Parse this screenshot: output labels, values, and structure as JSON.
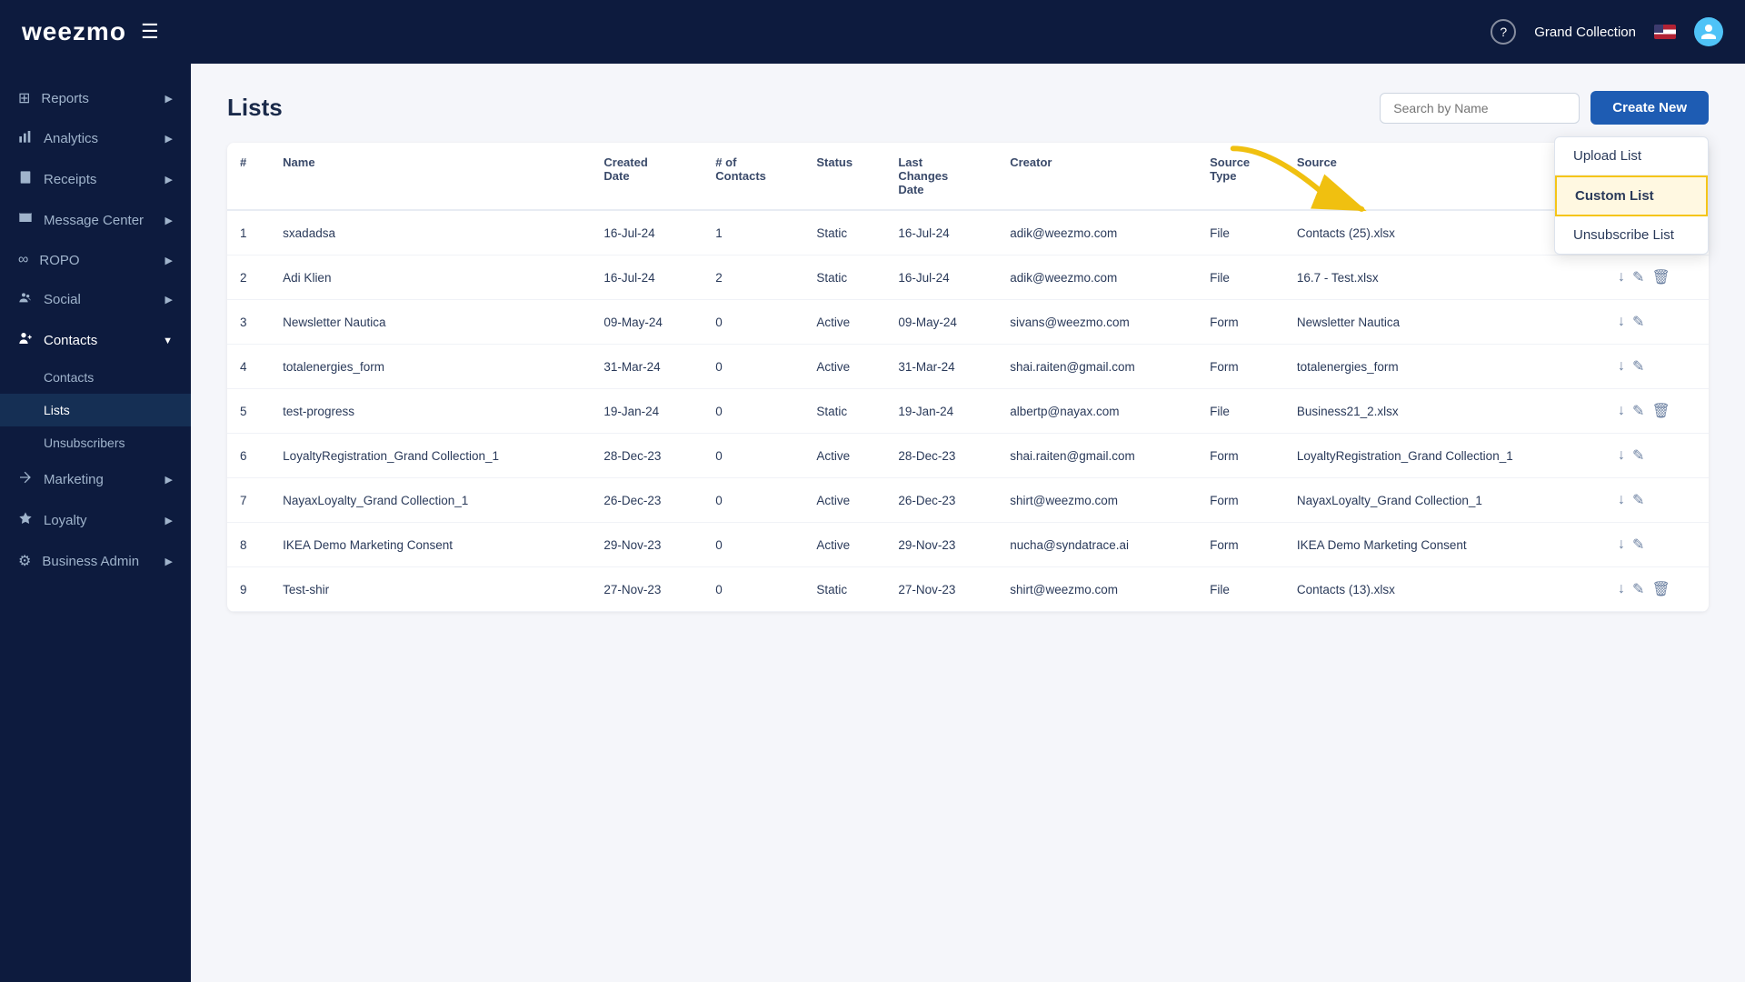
{
  "navbar": {
    "logo": "weezmo",
    "org_name": "Grand Collection",
    "help_label": "?",
    "user_icon": "person"
  },
  "sidebar": {
    "items": [
      {
        "id": "reports",
        "label": "Reports",
        "icon": "⊞",
        "arrow": "▶"
      },
      {
        "id": "analytics",
        "label": "Analytics",
        "icon": "📊",
        "arrow": "▶"
      },
      {
        "id": "receipts",
        "label": "Receipts",
        "icon": "🧾",
        "arrow": "▶"
      },
      {
        "id": "message-center",
        "label": "Message Center",
        "icon": "💬",
        "arrow": "▶"
      },
      {
        "id": "ropo",
        "label": "ROPO",
        "icon": "∞",
        "arrow": "▶"
      },
      {
        "id": "social",
        "label": "Social",
        "icon": "👥",
        "arrow": "▶"
      },
      {
        "id": "contacts",
        "label": "Contacts",
        "icon": "👤",
        "arrow": "▼"
      }
    ],
    "contacts_sub": [
      {
        "id": "contacts-sub",
        "label": "Contacts"
      },
      {
        "id": "lists",
        "label": "Lists"
      },
      {
        "id": "unsubscribers",
        "label": "Unsubscribers"
      }
    ],
    "bottom_items": [
      {
        "id": "marketing",
        "label": "Marketing",
        "icon": "📢",
        "arrow": "▶"
      },
      {
        "id": "loyalty",
        "label": "Loyalty",
        "icon": "🏷️",
        "arrow": "▶"
      },
      {
        "id": "business-admin",
        "label": "Business Admin",
        "icon": "⚙️",
        "arrow": "▶"
      }
    ]
  },
  "page": {
    "title": "Lists",
    "search_placeholder": "Search by Name",
    "create_btn": "Create New"
  },
  "dropdown": {
    "items": [
      {
        "id": "upload-list",
        "label": "Upload List",
        "highlighted": false
      },
      {
        "id": "custom-list",
        "label": "Custom List",
        "highlighted": true
      },
      {
        "id": "unsubscribe-list",
        "label": "Unsubscribe List",
        "highlighted": false
      }
    ]
  },
  "table": {
    "headers": [
      "#",
      "Name",
      "Created Date",
      "# of Contacts",
      "Status",
      "Last Changes Date",
      "Creator",
      "Source Type",
      "Source",
      ""
    ],
    "rows": [
      {
        "num": 1,
        "name": "sxadadsa",
        "created": "16-Jul-24",
        "contacts": 1,
        "status": "Static",
        "last_change": "16-Jul-24",
        "creator": "adik@weezmo.com",
        "source_type": "File",
        "source": "Contacts (25).xlsx",
        "has_delete": true
      },
      {
        "num": 2,
        "name": "Adi Klien",
        "created": "16-Jul-24",
        "contacts": 2,
        "status": "Static",
        "last_change": "16-Jul-24",
        "creator": "adik@weezmo.com",
        "source_type": "File",
        "source": "16.7 - Test.xlsx",
        "has_delete": true
      },
      {
        "num": 3,
        "name": "Newsletter Nautica",
        "created": "09-May-24",
        "contacts": 0,
        "status": "Active",
        "last_change": "09-May-24",
        "creator": "sivans@weezmo.com",
        "source_type": "Form",
        "source": "Newsletter Nautica",
        "has_delete": false
      },
      {
        "num": 4,
        "name": "totalenergies_form",
        "created": "31-Mar-24",
        "contacts": 0,
        "status": "Active",
        "last_change": "31-Mar-24",
        "creator": "shai.raiten@gmail.com",
        "source_type": "Form",
        "source": "totalenergies_form",
        "has_delete": false
      },
      {
        "num": 5,
        "name": "test-progress",
        "created": "19-Jan-24",
        "contacts": 0,
        "status": "Static",
        "last_change": "19-Jan-24",
        "creator": "albertp@nayax.com",
        "source_type": "File",
        "source": "Business21_2.xlsx",
        "has_delete": true
      },
      {
        "num": 6,
        "name": "LoyaltyRegistration_Grand Collection_1",
        "created": "28-Dec-23",
        "contacts": 0,
        "status": "Active",
        "last_change": "28-Dec-23",
        "creator": "shai.raiten@gmail.com",
        "source_type": "Form",
        "source": "LoyaltyRegistration_Grand Collection_1",
        "has_delete": false
      },
      {
        "num": 7,
        "name": "NayaxLoyalty_Grand Collection_1",
        "created": "26-Dec-23",
        "contacts": 0,
        "status": "Active",
        "last_change": "26-Dec-23",
        "creator": "shirt@weezmo.com",
        "source_type": "Form",
        "source": "NayaxLoyalty_Grand Collection_1",
        "has_delete": false
      },
      {
        "num": 8,
        "name": "IKEA Demo Marketing Consent",
        "created": "29-Nov-23",
        "contacts": 0,
        "status": "Active",
        "last_change": "29-Nov-23",
        "creator": "nucha@syndatrace.ai",
        "source_type": "Form",
        "source": "IKEA Demo Marketing Consent",
        "has_delete": false
      },
      {
        "num": 9,
        "name": "Test-shir",
        "created": "27-Nov-23",
        "contacts": 0,
        "status": "Static",
        "last_change": "27-Nov-23",
        "creator": "shirt@weezmo.com",
        "source_type": "File",
        "source": "Contacts (13).xlsx",
        "has_delete": true
      }
    ]
  }
}
